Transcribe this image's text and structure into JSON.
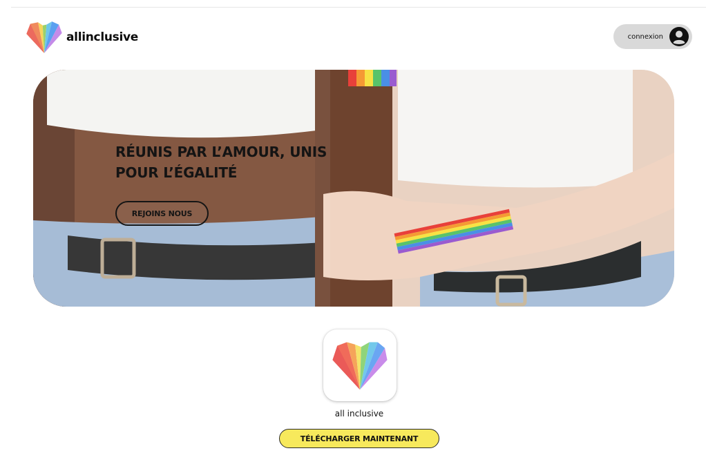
{
  "header": {
    "brand": "allinclusive",
    "login_label": "connexion",
    "logo_icon": "rainbow-heart-icon",
    "user_icon": "user-avatar-icon"
  },
  "hero": {
    "title": "RÉUNIS PAR L’AMOUR, UNIS POUR L’ÉGALITÉ",
    "cta_label": "REJOINS NOUS"
  },
  "app": {
    "name": "all inclusive",
    "icon": "rainbow-heart-icon",
    "download_label": "TÉLÉCHARGER MAINTENANT"
  },
  "colors": {
    "download_button": "#f7e95c",
    "login_pill": "#d9d9d9",
    "text": "#111111",
    "rainbow": [
      "#e8403a",
      "#f59a34",
      "#f7e244",
      "#59c36a",
      "#4a8fe6",
      "#9a5bd0"
    ]
  }
}
